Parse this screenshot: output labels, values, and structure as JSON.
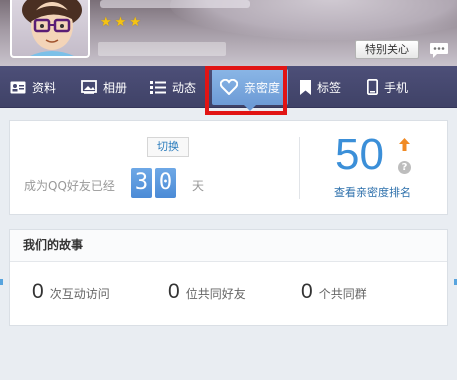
{
  "profile": {
    "stars": [
      "★",
      "★",
      "★"
    ],
    "special_care_label": "特别关心"
  },
  "nav": {
    "items": [
      {
        "label": "资料",
        "icon": "profile-card-icon"
      },
      {
        "label": "相册",
        "icon": "photo-album-icon"
      },
      {
        "label": "动态",
        "icon": "feed-list-icon"
      },
      {
        "label": "亲密度",
        "icon": "heart-icon",
        "active": true
      },
      {
        "label": "标签",
        "icon": "bookmark-icon"
      },
      {
        "label": "手机",
        "icon": "phone-icon"
      }
    ]
  },
  "intimacy": {
    "switch_label": "切换",
    "friend_days_label": "成为QQ好友已经",
    "days_digits": [
      "3",
      "0"
    ],
    "days_unit": "天",
    "score": "50",
    "rank_link": "查看亲密度排名",
    "help_glyph": "?"
  },
  "story": {
    "title": "我们的故事",
    "stats": [
      {
        "value": "0",
        "label": "次互动访问"
      },
      {
        "value": "0",
        "label": "位共同好友"
      },
      {
        "value": "0",
        "label": "个共同群"
      }
    ]
  },
  "colors": {
    "nav_bg": "#474a70",
    "active_tab": "#7aaae0",
    "highlight": "#e11414",
    "accent_blue": "#3b8fd8",
    "star": "#f5c313"
  }
}
